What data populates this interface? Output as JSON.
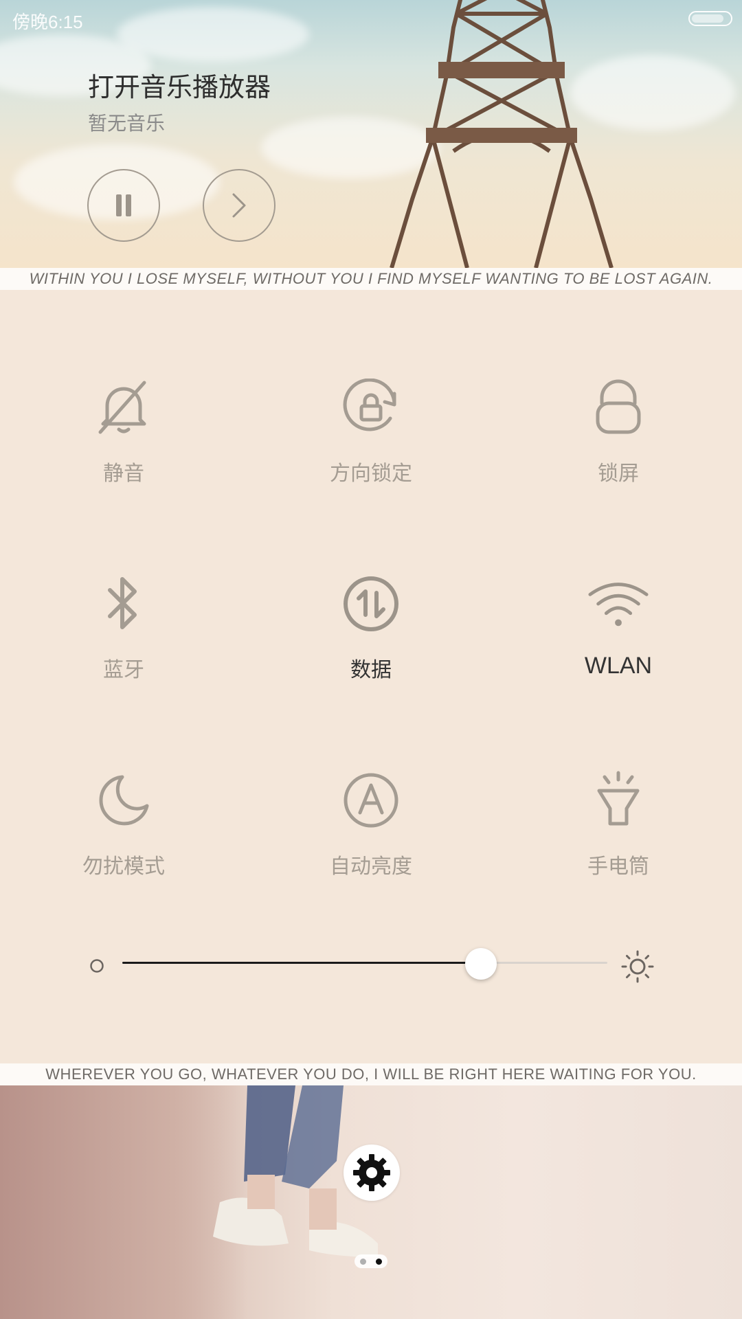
{
  "status_bar": {
    "time": "傍晚6:15",
    "battery_level": 0.85
  },
  "music": {
    "title": "打开音乐播放器",
    "subtitle": "暂无音乐",
    "pause_icon": "pause-icon",
    "next_icon": "chevron-right-icon"
  },
  "quotes": {
    "top": "WITHIN YOU I LOSE MYSELF, WITHOUT YOU I FIND MYSELF WANTING TO BE LOST AGAIN.",
    "bottom": "WHEREVER YOU GO, WHATEVER YOU DO, I WILL BE RIGHT HERE WAITING FOR YOU."
  },
  "toggles": [
    {
      "label": "静音",
      "icon": "bell-off-icon",
      "active": false
    },
    {
      "label": "方向锁定",
      "icon": "rotation-lock-icon",
      "active": false
    },
    {
      "label": "锁屏",
      "icon": "lock-icon",
      "active": false
    },
    {
      "label": "蓝牙",
      "icon": "bluetooth-icon",
      "active": false
    },
    {
      "label": "数据",
      "icon": "mobile-data-icon",
      "active": true
    },
    {
      "label": "WLAN",
      "icon": "wifi-icon",
      "active": true
    },
    {
      "label": "勿扰模式",
      "icon": "moon-icon",
      "active": false
    },
    {
      "label": "自动亮度",
      "icon": "auto-brightness-icon",
      "active": false
    },
    {
      "label": "手电筒",
      "icon": "flashlight-icon",
      "active": false
    }
  ],
  "brightness": {
    "level": 0.74,
    "min_icon": "brightness-low-icon",
    "max_icon": "brightness-high-icon"
  },
  "settings": {
    "icon": "gear-icon"
  },
  "pager": {
    "pages": 2,
    "current": 2
  },
  "colors": {
    "panel_bg": "#f4e7da",
    "icon_inactive": "#a49c92",
    "label_active": "#333333",
    "slider_fill": "#1a1a1a",
    "slider_track": "#d9d3cd"
  }
}
